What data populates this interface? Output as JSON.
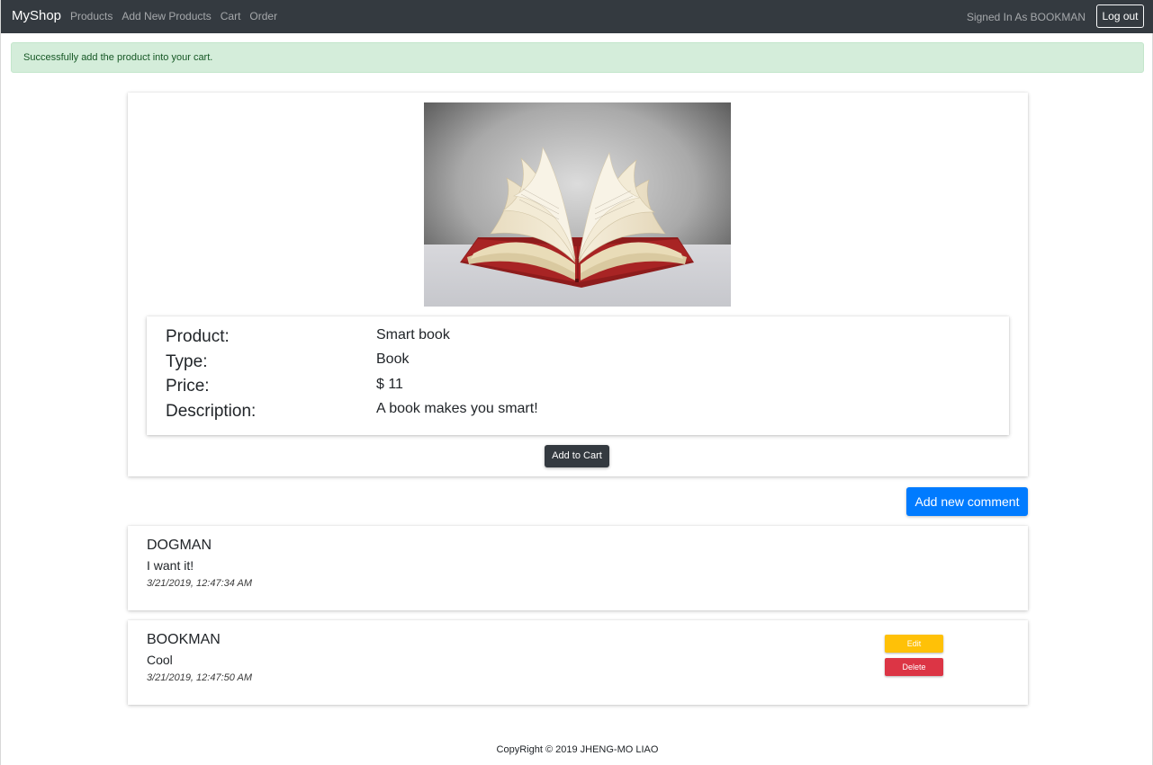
{
  "navbar": {
    "brand": "MyShop",
    "links": [
      "Products",
      "Add New Products",
      "Cart",
      "Order"
    ],
    "signed_in": "Signed In As BOOKMAN",
    "logout_label": "Log out"
  },
  "alert": {
    "message": "Successfully add the product into your cart."
  },
  "product": {
    "image_icon": "open-book-photo",
    "labels": {
      "product": "Product:",
      "type": "Type:",
      "price": "Price:",
      "description": "Description:"
    },
    "values": {
      "product": "Smart book",
      "type": "Book",
      "price": "$ 11",
      "description": "A book makes you smart!"
    },
    "add_to_cart_label": "Add to Cart"
  },
  "add_comment_label": "Add new comment",
  "comments": [
    {
      "author": "DOGMAN",
      "text": "I want it!",
      "time": "3/21/2019, 12:47:34 AM"
    },
    {
      "author": "BOOKMAN",
      "text": "Cool",
      "time": "3/21/2019, 12:47:50 AM",
      "edit_label": "Edit",
      "delete_label": "Delete"
    }
  ],
  "footer": {
    "text": "CopyRight © 2019 JHENG-MO LIAO"
  },
  "colors": {
    "navbar": "#343a40",
    "alert_bg": "#d4edda",
    "primary": "#007bff",
    "warning": "#ffc107",
    "danger": "#dc3545"
  }
}
